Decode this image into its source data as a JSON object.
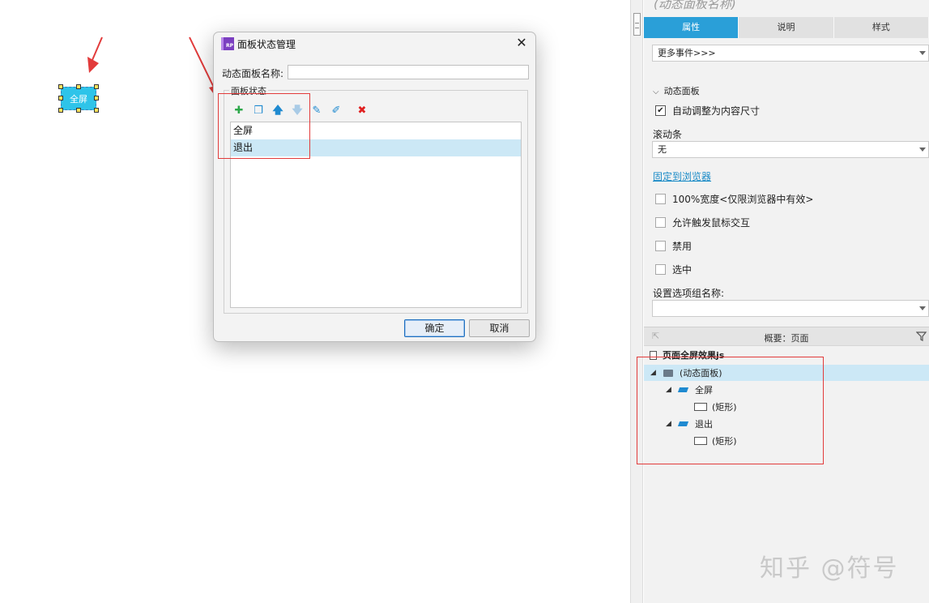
{
  "canvas": {
    "widget_label": "全屏"
  },
  "dialog": {
    "title": "面板状态管理",
    "logo": "RP",
    "close_glyph": "✕",
    "name_label": "动态面板名称:",
    "name_value": "",
    "group_legend": "面板状态",
    "toolbar": [
      {
        "icon": "add-icon",
        "glyph": "✚",
        "color": "#2da84a"
      },
      {
        "icon": "duplicate-icon",
        "glyph": "❐",
        "color": "#1f8ad0"
      },
      {
        "icon": "move-up-icon",
        "glyph": "🡅",
        "color": "#1f8ad0"
      },
      {
        "icon": "move-down-icon",
        "glyph": "🡇",
        "color": "#a9cbe6"
      },
      {
        "icon": "edit-state-icon",
        "glyph": "✎",
        "color": "#1f8ad0"
      },
      {
        "icon": "edit-all-icon",
        "glyph": "✐",
        "color": "#1f8ad0"
      },
      {
        "icon": "delete-icon",
        "glyph": "✖",
        "color": "#e02020"
      }
    ],
    "states": [
      {
        "label": "全屏",
        "selected": false
      },
      {
        "label": "退出",
        "selected": true
      }
    ],
    "ok_label": "确定",
    "cancel_label": "取消"
  },
  "panel": {
    "title": "(动态面板名称)",
    "tabs": [
      {
        "label": "属性",
        "active": true
      },
      {
        "label": "说明",
        "active": false
      },
      {
        "label": "样式",
        "active": false
      }
    ],
    "events_select": "更多事件>>>",
    "section_title": "动态面板",
    "auto_fit": {
      "label": "自动调整为内容尺寸",
      "checked": true
    },
    "scrollbar_label": "滚动条",
    "scrollbar_value": "无",
    "pin_link": "固定到浏览器",
    "checkboxes": [
      {
        "label": "100%宽度<仅限浏览器中有效>",
        "checked": false
      },
      {
        "label": "允许触发鼠标交互",
        "checked": false
      },
      {
        "label": "禁用",
        "checked": false
      },
      {
        "label": "选中",
        "checked": false
      }
    ],
    "group_name_label": "设置选项组名称:",
    "group_name_value": ""
  },
  "outline": {
    "title": "概要：页面",
    "back_glyph": "⇱",
    "page": "页面全屏效果js",
    "tree": [
      {
        "label": "(动态面板)",
        "level": 0,
        "type": "panel",
        "expanded": true,
        "selected": true
      },
      {
        "label": "全屏",
        "level": 1,
        "type": "state",
        "expanded": true,
        "selected": false
      },
      {
        "label": "(矩形)",
        "level": 2,
        "type": "rect",
        "expanded": false,
        "selected": false
      },
      {
        "label": "退出",
        "level": 1,
        "type": "state",
        "expanded": true,
        "selected": false
      },
      {
        "label": "(矩形)",
        "level": 2,
        "type": "rect",
        "expanded": false,
        "selected": false
      }
    ]
  },
  "watermark": "知乎 @符号",
  "colors": {
    "accent": "#2a9fd8",
    "annotation_red": "#e23b3b",
    "widget_fill": "#2ec4e9",
    "selection": "#cce8f6"
  }
}
